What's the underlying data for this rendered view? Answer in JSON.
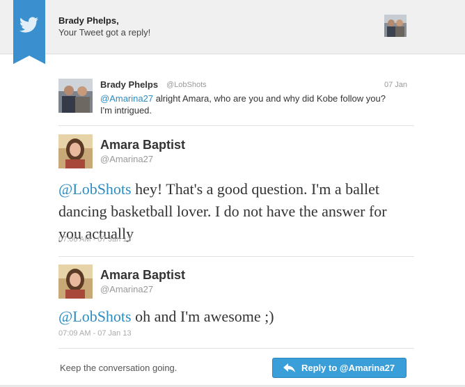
{
  "notification": {
    "recipient": "Brady Phelps,",
    "message": "Your Tweet got a reply!",
    "icon": "twitter-bird-icon"
  },
  "original_tweet": {
    "name": "Brady Phelps",
    "handle": "@LobShots",
    "date": "07 Jan",
    "mention": "@Amarina27",
    "text": " alright Amara, who are you and why did Kobe follow you? I'm intrigued."
  },
  "replies": [
    {
      "name": "Amara Baptist",
      "handle": "@Amarina27",
      "mention": "@LobShots",
      "text": " hey! That's a good question. I'm a ballet dancing basketball lover. I do not have the answer for you actually",
      "time": "07:06 AM - 07 Jan 13"
    },
    {
      "name": "Amara Baptist",
      "handle": "@Amarina27",
      "mention": "@LobShots",
      "text": " oh and I'm awesome ;)",
      "time": "07:09 AM - 07 Jan 13"
    }
  ],
  "footer": {
    "prompt": "Keep the conversation going.",
    "button_label": "Reply to @Amarina27",
    "button_icon": "reply-arrow-icon"
  },
  "colors": {
    "brand_blue": "#3a8fcf",
    "link": "#2b8cc4",
    "button": "#3a9ed9"
  }
}
